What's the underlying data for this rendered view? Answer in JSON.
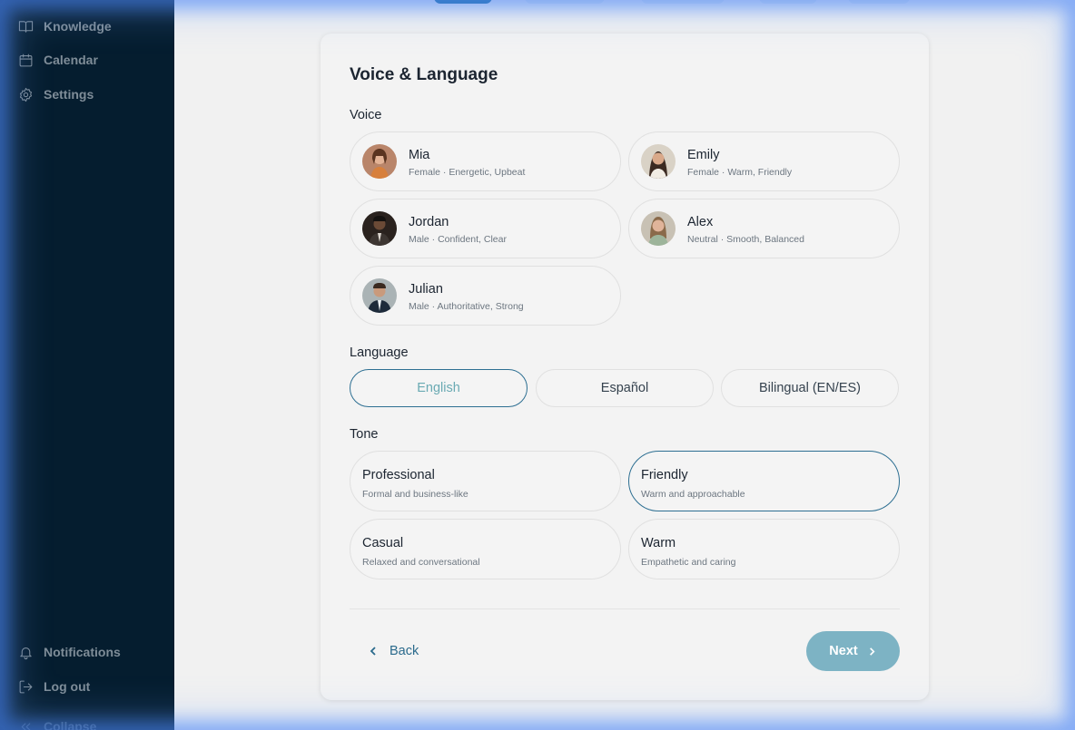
{
  "sidebar": {
    "top_items": [
      {
        "label": "Knowledge",
        "icon": "book-icon"
      },
      {
        "label": "Calendar",
        "icon": "calendar-icon"
      },
      {
        "label": "Settings",
        "icon": "gear-icon"
      }
    ],
    "bottom_items": [
      {
        "label": "Notifications",
        "icon": "bell-icon"
      },
      {
        "label": "Log out",
        "icon": "logout-icon"
      },
      {
        "label": "Collapse",
        "icon": "chevrons-left-icon"
      }
    ]
  },
  "card": {
    "title": "Voice & Language",
    "voice_label": "Voice",
    "voices": [
      {
        "name": "Mia",
        "desc": "Female · Energetic, Upbeat"
      },
      {
        "name": "Emily",
        "desc": "Female · Warm, Friendly"
      },
      {
        "name": "Jordan",
        "desc": "Male · Confident, Clear"
      },
      {
        "name": "Alex",
        "desc": "Neutral · Smooth, Balanced"
      },
      {
        "name": "Julian",
        "desc": "Male · Authoritative, Strong"
      }
    ],
    "language_label": "Language",
    "languages": [
      "English",
      "Español",
      "Bilingual (EN/ES)"
    ],
    "selected_language": "English",
    "tone_label": "Tone",
    "tones": [
      {
        "name": "Professional",
        "desc": "Formal and business-like"
      },
      {
        "name": "Friendly",
        "desc": "Warm and approachable"
      },
      {
        "name": "Casual",
        "desc": "Relaxed and conversational"
      },
      {
        "name": "Warm",
        "desc": "Empathetic and caring"
      }
    ],
    "selected_tone": "Friendly",
    "back_label": "Back",
    "next_label": "Next"
  },
  "colors": {
    "sidebar_bg": "#051d2f",
    "accent": "#2d6f92",
    "next_button": "#7db3c4",
    "selected_language_text": "#6aaab3"
  }
}
